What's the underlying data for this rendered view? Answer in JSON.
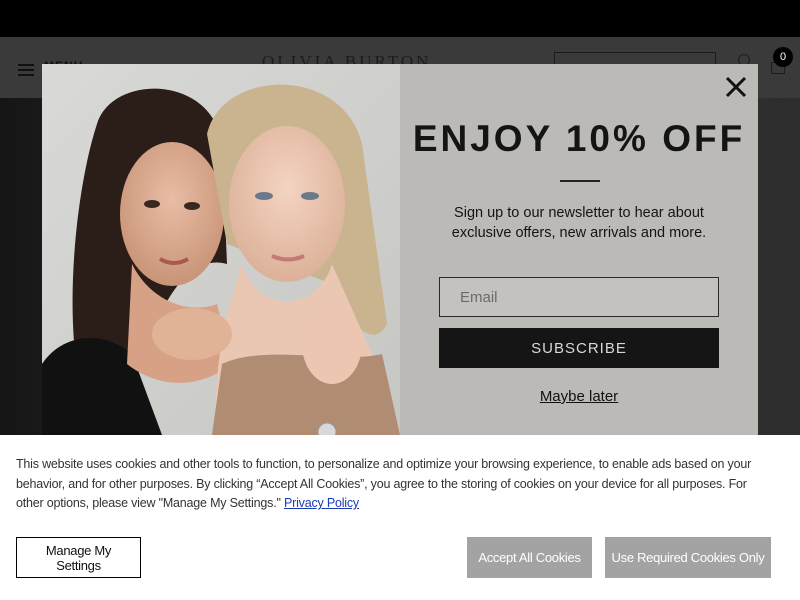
{
  "header": {
    "menu_label": "MENU",
    "brand_name": "OLIVIA BURTON",
    "cart_count": "0"
  },
  "modal": {
    "title": "ENJOY 10% OFF",
    "description": "Sign up to our newsletter to hear about exclusive offers, new arrivals and more.",
    "email_placeholder": "Email",
    "subscribe_label": "SUBSCRIBE",
    "maybe_later_label": "Maybe later",
    "close_icon": "close-icon"
  },
  "cookie_banner": {
    "text": "This website uses cookies and other tools to function, to personalize and optimize your browsing experience, to enable ads based on your behavior, and for other purposes. By clicking “Accept All Cookies”, you agree to the storing of cookies on your device for all purposes. For other options, please view \"Manage My Settings.\"",
    "privacy_link_label": "Privacy Policy",
    "manage_label": "Manage My Settings",
    "accept_all_label": "Accept All Cookies",
    "required_only_label": "Use Required Cookies Only"
  },
  "colors": {
    "modal_background": "#bbbab6",
    "dark_button": "#151515",
    "cookie_button": "#a3a3a3",
    "link": "#1a3bb8"
  }
}
